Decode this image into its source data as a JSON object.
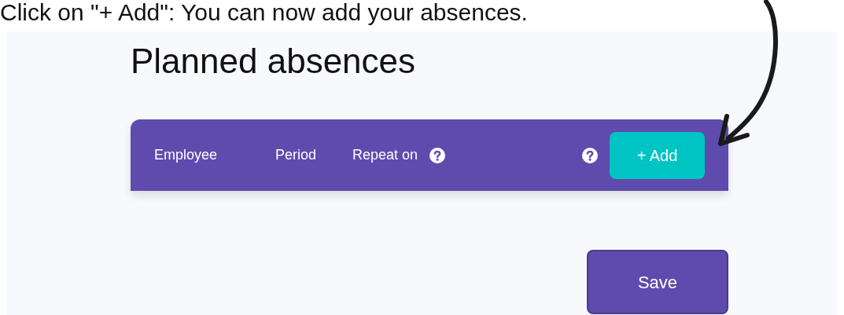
{
  "caption": "Click on \"+ Add\": You can now add your absences.",
  "heading": "Planned absences",
  "columns": [
    "Employee",
    "Period",
    "Repeat on"
  ],
  "add_button": "+ Add",
  "save_button": "Save"
}
